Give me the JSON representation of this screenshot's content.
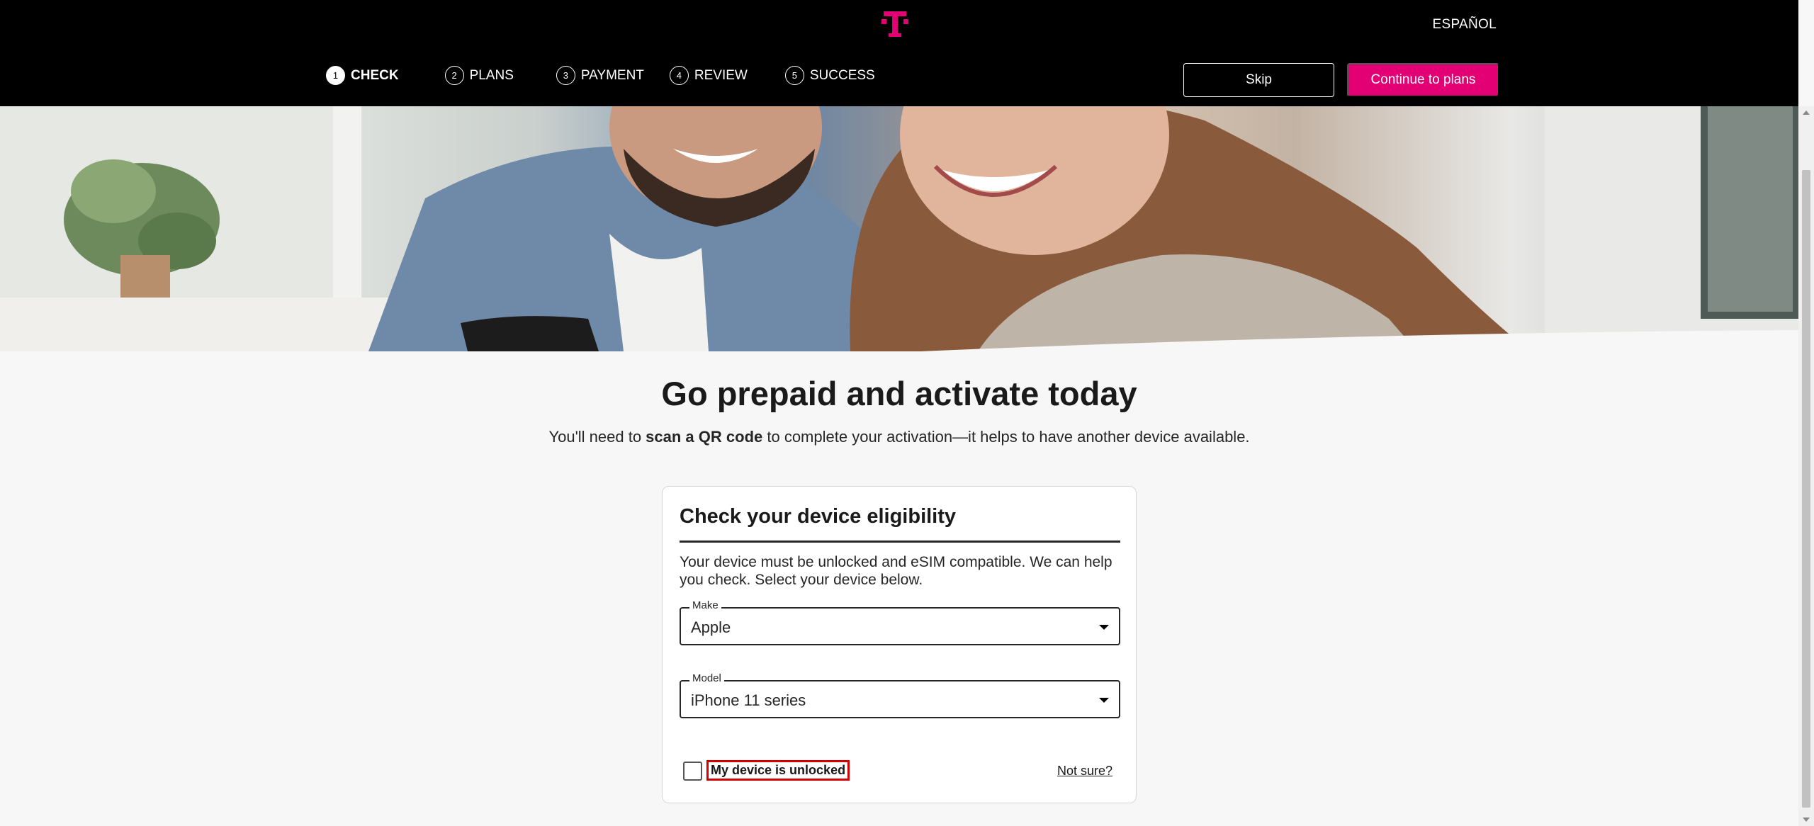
{
  "header": {
    "language_link": "ESPAÑOL",
    "steps": [
      {
        "number": "1",
        "label": "CHECK",
        "active": true
      },
      {
        "number": "2",
        "label": "PLANS",
        "active": false
      },
      {
        "number": "3",
        "label": "PAYMENT",
        "active": false
      },
      {
        "number": "4",
        "label": "REVIEW",
        "active": false
      },
      {
        "number": "5",
        "label": "SUCCESS",
        "active": false
      }
    ],
    "skip_label": "Skip",
    "continue_label": "Continue to plans",
    "brand_color": "#e20074",
    "logo_icon": "t-mobile-logo-icon"
  },
  "main": {
    "headline": "Go prepaid and activate today",
    "subline_before": "You'll need to ",
    "subline_bold": "scan a QR code",
    "subline_after": " to complete your activation—it helps to have another device available."
  },
  "card": {
    "title": "Check your device eligibility",
    "description": "Your device must be unlocked and eSIM compatible. We can help you check. Select your device below.",
    "make": {
      "label": "Make",
      "value": "Apple"
    },
    "model": {
      "label": "Model",
      "value": "iPhone 11 series"
    },
    "unlocked_checkbox_label": "My device is unlocked",
    "not_sure_link": "Not sure?"
  }
}
